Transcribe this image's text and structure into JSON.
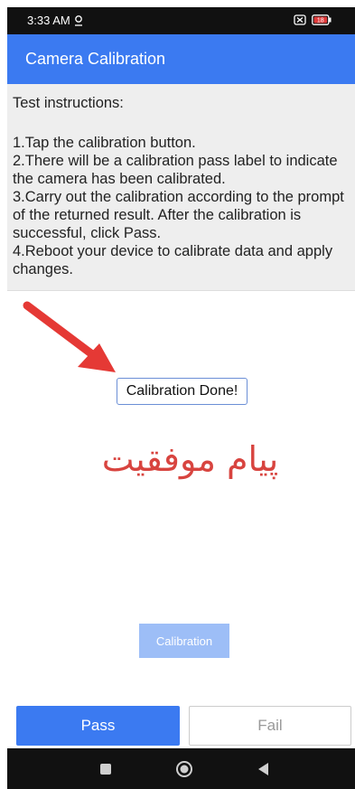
{
  "status_bar": {
    "time": "3:33 AM",
    "battery": "18"
  },
  "app_bar": {
    "title": "Camera Calibration"
  },
  "instructions": {
    "heading": "Test instructions:",
    "steps": [
      "1.Tap the calibration button.",
      "2.There will be a calibration pass label to indicate the camera has been calibrated.",
      "3.Carry out the calibration according to the prompt of the returned result. After the calibration is successful, click Pass.",
      "4.Reboot your device to calibrate data and apply changes."
    ]
  },
  "result": {
    "label": "Calibration Done!",
    "annotation": "پیام موفقیت"
  },
  "buttons": {
    "calibration": "Calibration",
    "pass": "Pass",
    "fail": "Fail"
  },
  "colors": {
    "accent": "#3b7af1",
    "annotation": "#d8443f"
  },
  "icons": {
    "status": [
      "location-pin-icon",
      "sim-off-icon",
      "battery-icon"
    ],
    "annotation": "red-arrow-icon",
    "nav": [
      "recents-square-icon",
      "home-circle-icon",
      "back-triangle-icon"
    ]
  }
}
